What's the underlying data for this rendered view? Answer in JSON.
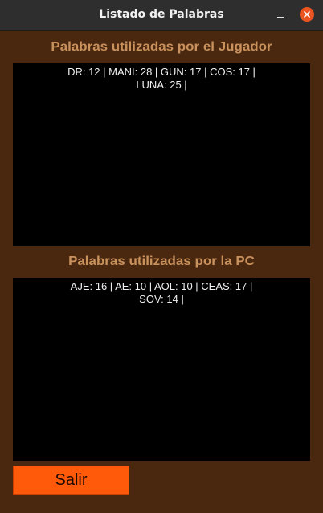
{
  "window": {
    "title": "Listado de Palabras"
  },
  "player": {
    "heading": "Palabras utilizadas por el Jugador",
    "words_line1": "DR: 12 | MANI: 28 | GUN: 17 | COS: 17 |",
    "words_line2": "LUNA: 25 |"
  },
  "pc": {
    "heading": "Palabras utilizadas por la PC",
    "words_line1": "AJE: 16 | AE: 10 | AOL: 10 | CEAS: 17 |",
    "words_line2": "SOV: 14 |"
  },
  "actions": {
    "exit_label": "Salir"
  },
  "colors": {
    "background": "#4a2810",
    "heading": "#c9915c",
    "panel": "#000000",
    "button": "#fe5a0a",
    "close": "#e95420"
  }
}
